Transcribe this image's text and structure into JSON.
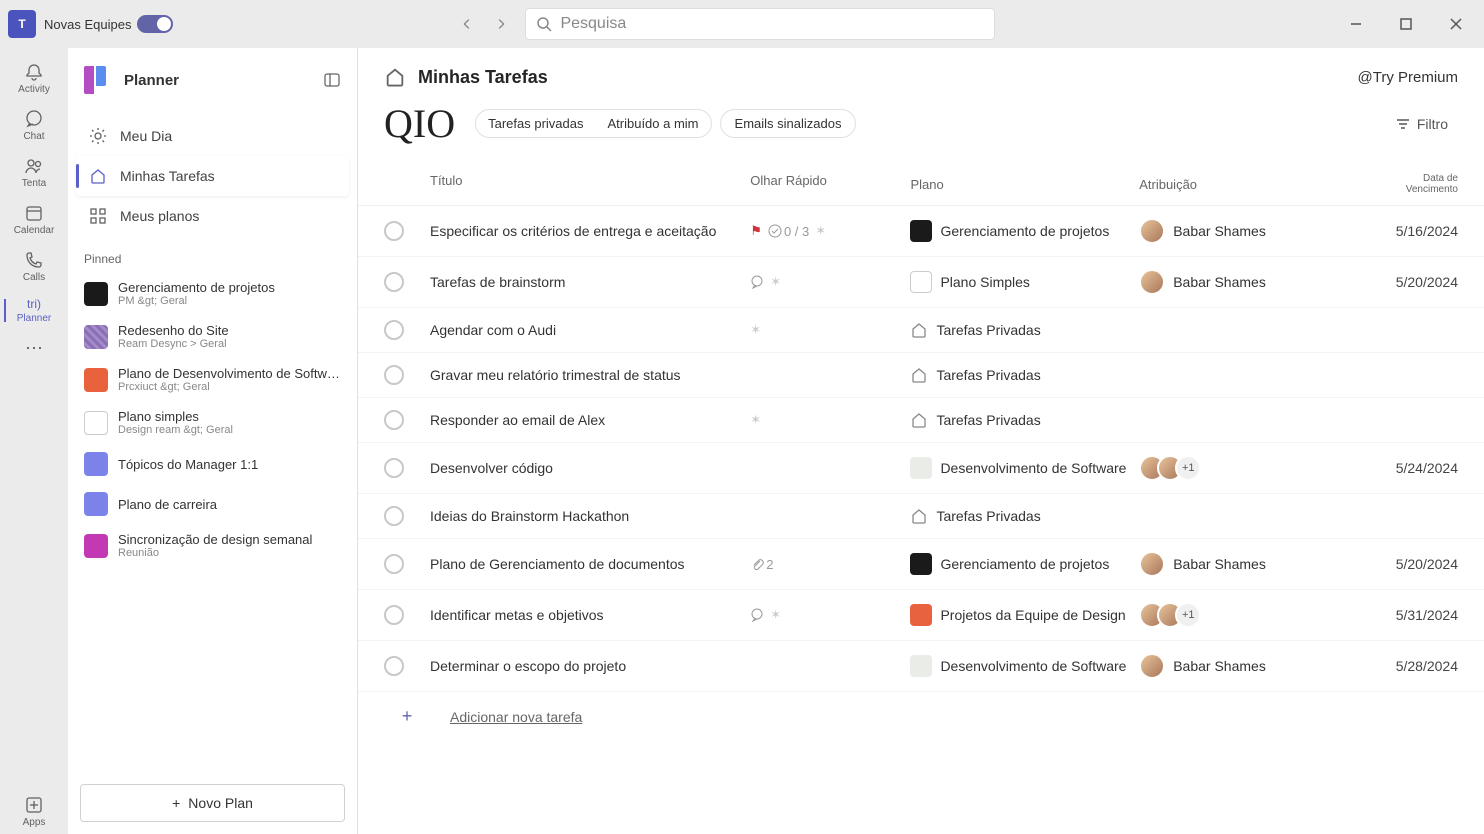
{
  "titlebar": {
    "toggle_label": "Novas Equipes",
    "search_placeholder": "Pesquisa"
  },
  "rail": {
    "items": [
      {
        "label": "Activity"
      },
      {
        "label": "Chat"
      },
      {
        "label": "Tenta"
      },
      {
        "label": "Calendar"
      },
      {
        "label": "Calls"
      },
      {
        "label": "Planner",
        "badge": "tri)"
      },
      {
        "label": "Apps"
      }
    ]
  },
  "sidebar": {
    "title": "Planner",
    "nav": [
      {
        "label": "Meu Dia"
      },
      {
        "label": "Minhas Tarefas"
      },
      {
        "label": "Meus planos"
      }
    ],
    "pinned_label": "Pinned",
    "pinned": [
      {
        "title": "Gerenciamento de projetos",
        "sub": "PM &gt; Geral",
        "color": "#1a1a1a"
      },
      {
        "title": "Redesenho do Site",
        "sub": "Ream Desync > Geral",
        "color": "#8a6fb5",
        "pattern": true
      },
      {
        "title": "Plano de Desenvolvimento de Software",
        "sub": "Prcxiuct &gt; Geral",
        "color": "#e8623d"
      },
      {
        "title": "Plano simples",
        "sub": "Design ream &gt; Geral",
        "color": "#ffffff",
        "border": true
      },
      {
        "title": "Tópicos do Manager 1:1",
        "sub": "",
        "color": "#7b83eb"
      },
      {
        "title": "Plano de carreira",
        "sub": "",
        "color": "#7b83eb"
      },
      {
        "title": "Sincronização de design semanal",
        "sub": "Reunião",
        "color": "#c239b3"
      }
    ],
    "new_plan_label": "Novo Plan"
  },
  "content": {
    "page_title": "Minhas Tarefas",
    "premium": "@Try Premium",
    "qio": "QIO",
    "pill_private": "Tarefas privadas",
    "pill_assigned": "Atribuído a mim",
    "pill_flagged": "Emails sinalizados",
    "filter_label": "Filtro",
    "columns": {
      "title": "Título",
      "quick": "Olhar Rápido",
      "plan": "Plano",
      "assign": "Atribuição",
      "due": "Data de Vencimento"
    },
    "tasks": [
      {
        "title": "Especificar os critérios de entrega e aceitação",
        "quick": [
          "flag",
          "check:0 / 3",
          "sun"
        ],
        "plan": {
          "name": "Gerenciamento de projetos",
          "color": "#1a1a1a"
        },
        "assign": {
          "type": "single",
          "name": "Babar Shames"
        },
        "due": "5/16/2024"
      },
      {
        "title": "Tarefas de brainstorm",
        "quick": [
          "comment",
          "sun"
        ],
        "plan": {
          "name": "Plano Simples",
          "color": "#ffffff",
          "border": true
        },
        "assign": {
          "type": "single",
          "name": "Babar Shames"
        },
        "due": "5/20/2024"
      },
      {
        "title": "Agendar com o Audi",
        "quick": [
          "sun"
        ],
        "plan": {
          "name": "Tarefas Privadas",
          "icon": "home"
        },
        "assign": {
          "type": "none"
        },
        "due": ""
      },
      {
        "title": "Gravar meu relatório trimestral de status",
        "quick": [],
        "plan": {
          "name": "Tarefas Privadas",
          "icon": "home"
        },
        "assign": {
          "type": "none"
        },
        "due": ""
      },
      {
        "title": "Responder ao email de Alex",
        "quick": [
          "sun"
        ],
        "plan": {
          "name": "Tarefas Privadas",
          "icon": "home"
        },
        "assign": {
          "type": "none"
        },
        "due": ""
      },
      {
        "title": "Desenvolver código",
        "quick": [],
        "plan": {
          "name": "Desenvolvimento de Software",
          "color": "#e9ece7"
        },
        "assign": {
          "type": "multi",
          "more": "+1"
        },
        "due": "5/24/2024"
      },
      {
        "title": "Ideias do Brainstorm Hackathon",
        "quick": [],
        "plan": {
          "name": "Tarefas Privadas",
          "icon": "home"
        },
        "assign": {
          "type": "none"
        },
        "due": ""
      },
      {
        "title": "Plano de Gerenciamento de documentos",
        "quick": [
          "attach:2"
        ],
        "plan": {
          "name": "Gerenciamento de projetos",
          "color": "#1a1a1a"
        },
        "assign": {
          "type": "single",
          "name": "Babar Shames"
        },
        "due": "5/20/2024"
      },
      {
        "title": "Identificar metas e objetivos",
        "quick": [
          "comment",
          "sun"
        ],
        "plan": {
          "name": "Projetos da Equipe de Design",
          "color": "#e8623d"
        },
        "assign": {
          "type": "multi",
          "more": "+1"
        },
        "due": "5/31/2024"
      },
      {
        "title": "Determinar o escopo do projeto",
        "quick": [],
        "plan": {
          "name": "Desenvolvimento de Software",
          "color": "#e9ece7"
        },
        "assign": {
          "type": "single",
          "name": "Babar Shames"
        },
        "due": "5/28/2024"
      }
    ],
    "add_task_label": "Adicionar nova tarefa"
  }
}
